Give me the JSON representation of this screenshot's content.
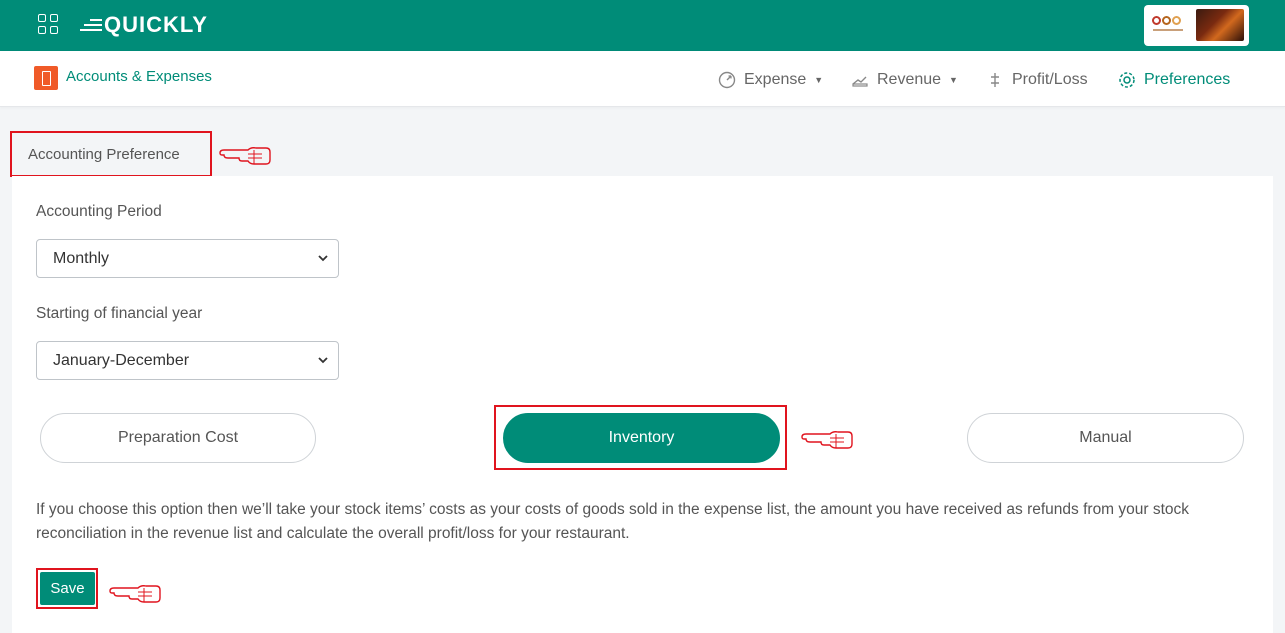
{
  "topbar": {
    "logo_text": "QUICKLY",
    "apps_icon": "grid-icon",
    "brand_logo": "restaurant-brand-logo"
  },
  "subnav": {
    "module_title": "Accounts & Expenses",
    "items": [
      {
        "label": "Expense",
        "icon": "expense-icon",
        "dropdown": true
      },
      {
        "label": "Revenue",
        "icon": "revenue-icon",
        "dropdown": true
      },
      {
        "label": "Profit/Loss",
        "icon": "profit-loss-icon",
        "dropdown": false
      },
      {
        "label": "Preferences",
        "icon": "gear-icon",
        "dropdown": false,
        "active": true
      }
    ]
  },
  "section_title": "Accounting Preference",
  "form": {
    "period_label": "Accounting Period",
    "period_value": "Monthly",
    "fy_label": "Starting of financial year",
    "fy_value": "January-December",
    "options": [
      {
        "label": "Preparation Cost",
        "active": false
      },
      {
        "label": "Inventory",
        "active": true
      },
      {
        "label": "Manual",
        "active": false
      }
    ],
    "description": "If you choose this option then we’ll take your stock items’ costs as your costs of goods sold in the expense list, the amount you have received as refunds from your stock reconciliation in the revenue list and calculate the overall profit/loss for your restaurant.",
    "save_label": "Save"
  },
  "colors": {
    "brand": "#008c78",
    "highlight": "#e0141e",
    "module_icon": "#f05a28"
  }
}
